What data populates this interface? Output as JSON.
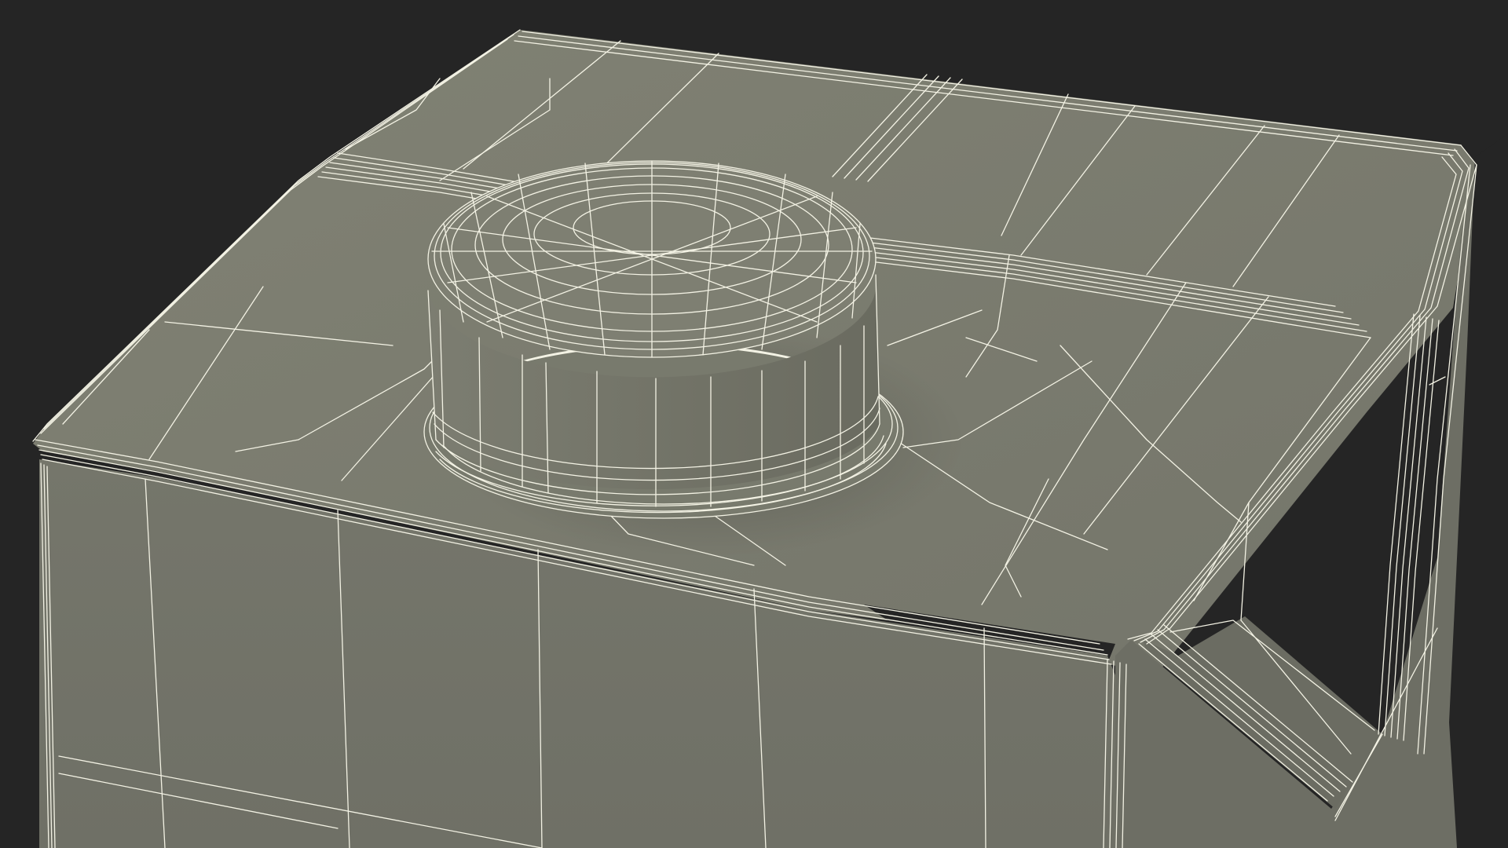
{
  "scene": {
    "subject": "carton-with-screw-cap",
    "view": "wireframe-render"
  },
  "colors": {
    "background": "#252525",
    "surface_top": "#7b7c6e",
    "surface_front": "#73746a",
    "surface_side": "#6c6d63",
    "cap": "#76776b",
    "wire": "#f3f2e4"
  }
}
